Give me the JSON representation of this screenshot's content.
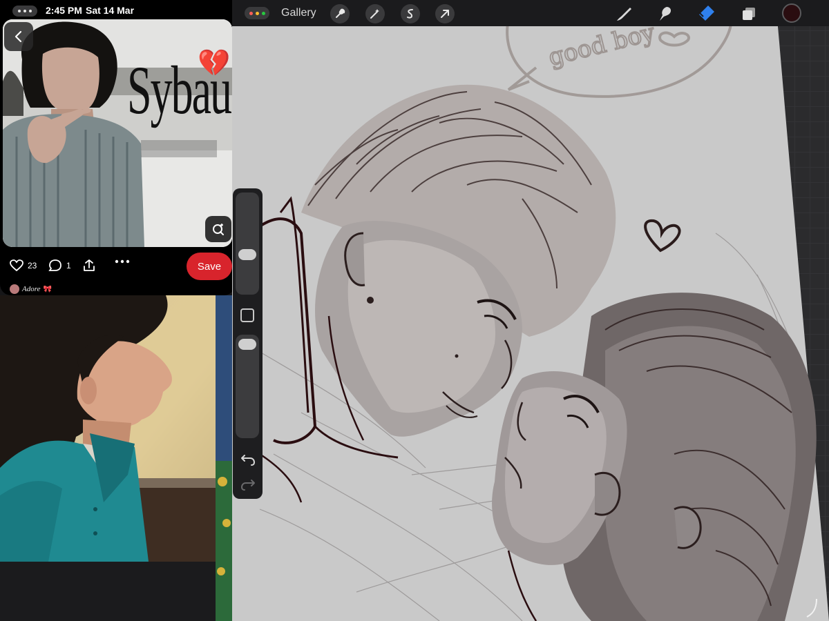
{
  "status_bar": {
    "time": "2:45 PM",
    "date": "Sat 14 Mar"
  },
  "pinterest": {
    "pin_text": "Sybau",
    "pin_emoji": "💔",
    "likes": "23",
    "comments": "1",
    "save_label": "Save",
    "board_name": "Adore",
    "board_emoji": "🎀"
  },
  "procreate": {
    "gallery_label": "Gallery",
    "current_color": "#2a0d10",
    "canvas_text": "good boy",
    "tools_left": [
      "wrench-icon",
      "magic-wand-icon",
      "selection-icon",
      "transform-arrow-icon"
    ],
    "tools_right": [
      "brush-icon",
      "smudge-icon",
      "eraser-icon",
      "layers-icon"
    ]
  },
  "colors": {
    "accent_eraser": "#2f80ed",
    "save_red": "#d8242c",
    "canvas_gray": "#c9c9c9"
  }
}
